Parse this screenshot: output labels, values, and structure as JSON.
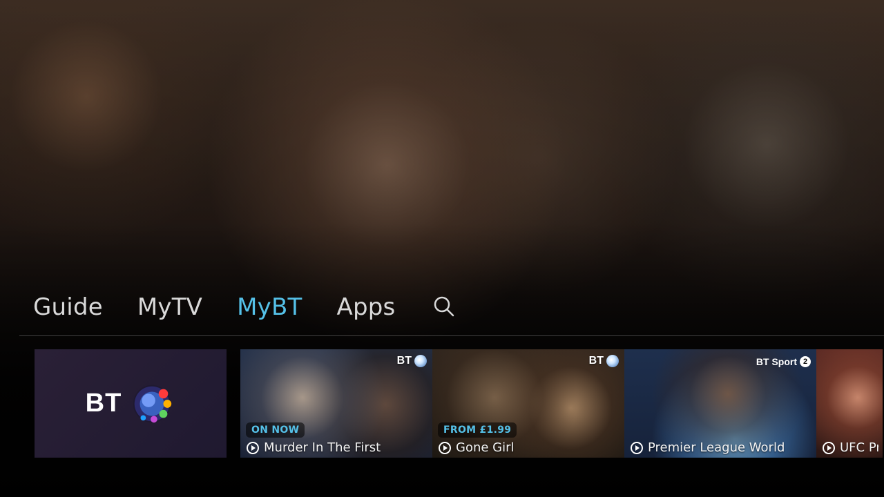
{
  "nav": {
    "items": [
      "Guide",
      "MyTV",
      "MyBT",
      "Apps"
    ],
    "active": "MyBT",
    "search_icon": "search-icon"
  },
  "colors": {
    "accent": "#55c1e8",
    "nav_text": "#d9d9d9"
  },
  "carousel": {
    "logo_tile": {
      "label": "BT"
    },
    "tiles": [
      {
        "badge": "ON NOW",
        "title": "Murder In The First",
        "channel": "BT",
        "icon": "play-icon"
      },
      {
        "badge": "FROM £1.99",
        "title": "Gone Girl",
        "channel": "BT",
        "icon": "play-icon"
      },
      {
        "badge": "",
        "title": "Premier League World",
        "channel": "BT Sport",
        "channel_number": "2",
        "icon": "play-icon"
      },
      {
        "badge": "",
        "title": "UFC Pri",
        "channel": "",
        "icon": "play-icon"
      }
    ]
  }
}
